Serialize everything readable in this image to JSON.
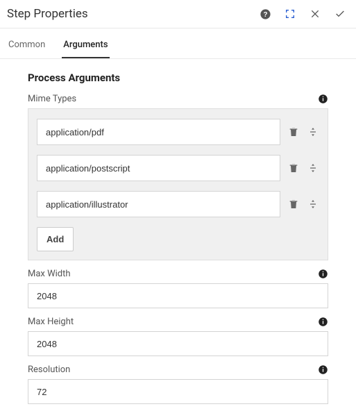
{
  "header": {
    "title": "Step Properties"
  },
  "tabs": {
    "common": "Common",
    "arguments": "Arguments"
  },
  "section": {
    "heading": "Process Arguments"
  },
  "fields": {
    "mimeTypes": {
      "label": "Mime Types",
      "items": [
        {
          "value": "application/pdf"
        },
        {
          "value": "application/postscript"
        },
        {
          "value": "application/illustrator"
        }
      ],
      "addLabel": "Add"
    },
    "maxWidth": {
      "label": "Max Width",
      "value": "2048"
    },
    "maxHeight": {
      "label": "Max Height",
      "value": "2048"
    },
    "resolution": {
      "label": "Resolution",
      "value": "72"
    }
  }
}
